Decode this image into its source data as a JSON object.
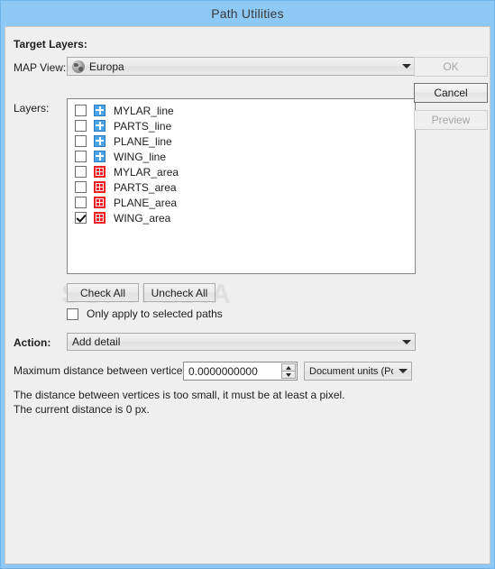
{
  "window": {
    "title": "Path Utilities",
    "titlebar_color": "#8ec8f5",
    "body_color": "#efefef",
    "watermark": "SOFTPEDIA"
  },
  "sections": {
    "target_layers_label": "Target Layers:",
    "map_view_label": "MAP View:",
    "layers_label": "Layers:",
    "action_label": "Action:"
  },
  "map_view": {
    "icon": "globe-icon",
    "selected": "Europa"
  },
  "layers": [
    {
      "name": "MYLAR_line",
      "checked": false,
      "type": "line",
      "icon": "line-layer-icon"
    },
    {
      "name": "PARTS_line",
      "checked": false,
      "type": "line",
      "icon": "line-layer-icon"
    },
    {
      "name": "PLANE_line",
      "checked": false,
      "type": "line",
      "icon": "line-layer-icon"
    },
    {
      "name": "WING_line",
      "checked": false,
      "type": "line",
      "icon": "line-layer-icon"
    },
    {
      "name": "MYLAR_area",
      "checked": false,
      "type": "area",
      "icon": "area-layer-icon"
    },
    {
      "name": "PARTS_area",
      "checked": false,
      "type": "area",
      "icon": "area-layer-icon"
    },
    {
      "name": "PLANE_area",
      "checked": false,
      "type": "area",
      "icon": "area-layer-icon"
    },
    {
      "name": "WING_area",
      "checked": true,
      "type": "area",
      "icon": "area-layer-icon"
    }
  ],
  "list_buttons": {
    "check_all": "Check All",
    "uncheck_all": "Uncheck All"
  },
  "only_selected": {
    "label": "Only apply to selected paths",
    "checked": false
  },
  "action": {
    "selected": "Add detail"
  },
  "max_distance": {
    "label": "Maximum distance between vertices:",
    "value": "0.0000000000",
    "units_selected": "Document units (Points)"
  },
  "messages": {
    "line1": "The distance between vertices is too small, it must be at least a pixel.",
    "line2": "The current distance is 0 px."
  },
  "dialog_buttons": {
    "ok": "OK",
    "cancel": "Cancel",
    "preview": "Preview"
  }
}
